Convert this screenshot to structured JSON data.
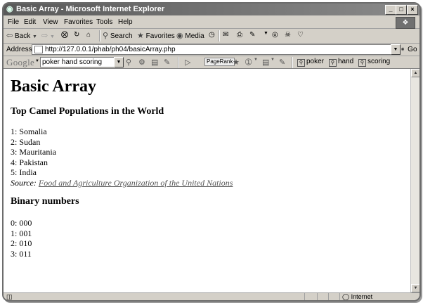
{
  "window": {
    "title": "Basic Array - Microsoft Internet Explorer"
  },
  "menu": [
    "File",
    "Edit",
    "View",
    "Favorites",
    "Tools",
    "Help"
  ],
  "toolbar": {
    "back": "Back",
    "search": "Search",
    "favorites": "Favorites",
    "media": "Media"
  },
  "address": {
    "label": "Address",
    "url": "http://127.0.0.1/phab/ph04/basicArray.php",
    "go": "Go"
  },
  "google": {
    "logo": "Google",
    "query": "poker hand scoring",
    "pagerank": "PageRank",
    "buttons": [
      "poker",
      "hand",
      "scoring"
    ]
  },
  "page": {
    "heading": "Basic Array",
    "section1_title": "Top Camel Populations in the World",
    "camels": [
      "1: Somalia",
      "2: Sudan",
      "3: Mauritania",
      "4: Pakistan",
      "5: India"
    ],
    "source_label": "Source:",
    "source_link": "Food and Agriculture Organization of the United Nations",
    "section2_title": "Binary numbers",
    "binary": [
      "0: 000",
      "1: 001",
      "2: 010",
      "3: 011"
    ]
  },
  "status": {
    "zone": "Internet"
  }
}
